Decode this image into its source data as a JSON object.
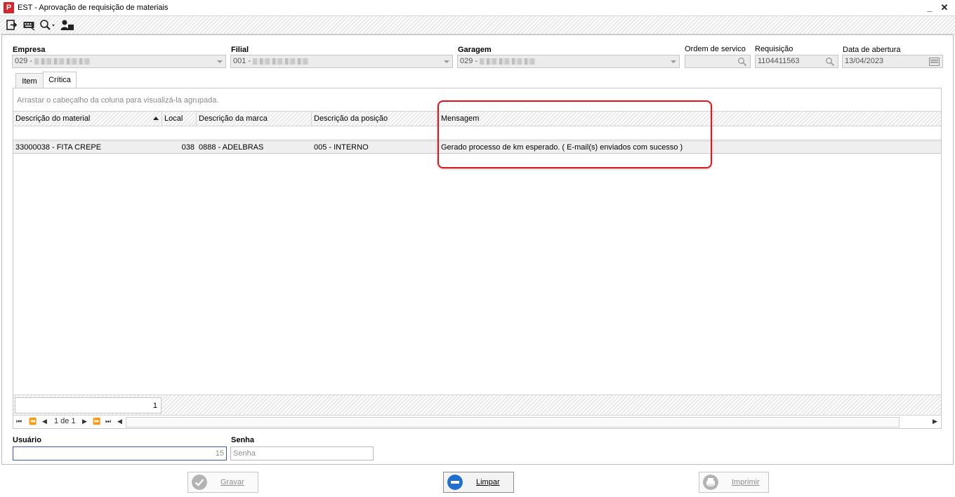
{
  "window": {
    "icon_letter": "P",
    "title": "EST - Aprovação de requisição de materiais",
    "minimize": "_",
    "close": "✕"
  },
  "toolbar": {
    "icons": [
      "exit-icon",
      "keyboard-icon",
      "search-icon",
      "user-card-icon"
    ]
  },
  "fields": {
    "empresa": {
      "label": "Empresa",
      "value": "029 -"
    },
    "filial": {
      "label": "Filial",
      "value": "001 -"
    },
    "garagem": {
      "label": "Garagem",
      "value": "029 -"
    },
    "ordem_servico": {
      "label": "Ordem de servico",
      "value": ""
    },
    "requisicao": {
      "label": "Requisição",
      "value": "1104411563"
    },
    "data_abertura": {
      "label": "Data de abertura",
      "value": "13/04/2023"
    }
  },
  "tabs": [
    {
      "label": "Item",
      "active": false
    },
    {
      "label": "Crítica",
      "active": true
    }
  ],
  "grid": {
    "group_hint": "Arrastar o cabeçalho da coluna para visualizá-la agrupada.",
    "columns": [
      "Descrição do material",
      "Local",
      "Descrição da marca",
      "Descrição da posição",
      "Mensagem"
    ],
    "sorted_column": "Descrição do material",
    "rows": [
      {
        "material": "33000038 - FITA CREPE",
        "local": "038",
        "marca": "0888 - ADELBRAS",
        "posicao": "005 - INTERNO",
        "mensagem": "Gerado processo de km esperado. ( E-mail(s) enviados com sucesso )"
      }
    ],
    "footer_count": "1",
    "pager_text": "1 de 1"
  },
  "login": {
    "usuario_label": "Usuário",
    "usuario_value": "15",
    "senha_label": "Senha",
    "senha_placeholder": "Senha"
  },
  "buttons": {
    "gravar": "Gravar",
    "limpar": "Limpar",
    "imprimir": "Imprimir"
  },
  "colors": {
    "highlight": "#e0161d",
    "app_icon": "#d9252a",
    "limpar_icon": "#1f6fd1"
  }
}
